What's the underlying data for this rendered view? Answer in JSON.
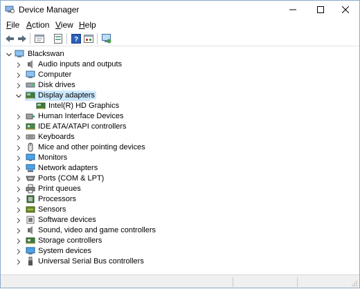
{
  "window": {
    "title": "Device Manager",
    "icon": "device-manager-icon",
    "controls": [
      "minimize-icon",
      "maximize-icon",
      "close-icon"
    ]
  },
  "menu": [
    {
      "label": "File",
      "underline": "F",
      "rest": "ile"
    },
    {
      "label": "Action",
      "underline": "A",
      "rest": "ction"
    },
    {
      "label": "View",
      "underline": "V",
      "rest": "iew"
    },
    {
      "label": "Help",
      "underline": "H",
      "rest": "elp"
    }
  ],
  "toolbar": {
    "buttons": [
      "back-arrow-icon",
      "forward-arrow-icon",
      "properties-icon",
      "update-driver-icon",
      "help-icon",
      "show-hidden-icon",
      "scan-hardware-icon"
    ]
  },
  "tree": {
    "root": "Blackswan",
    "items": [
      {
        "label": "Audio inputs and outputs",
        "icon": "speaker-icon",
        "expanded": false
      },
      {
        "label": "Computer",
        "icon": "computer-icon",
        "expanded": false
      },
      {
        "label": "Disk drives",
        "icon": "disk-drive-icon",
        "expanded": false
      },
      {
        "label": "Display adapters",
        "icon": "display-adapter-icon",
        "expanded": true,
        "selected": true,
        "children": [
          {
            "label": "Intel(R) HD Graphics",
            "icon": "display-adapter-icon"
          }
        ]
      },
      {
        "label": "Human Interface Devices",
        "icon": "hid-icon",
        "expanded": false
      },
      {
        "label": "IDE ATA/ATAPI controllers",
        "icon": "ide-controller-icon",
        "expanded": false
      },
      {
        "label": "Keyboards",
        "icon": "keyboard-icon",
        "expanded": false
      },
      {
        "label": "Mice and other pointing devices",
        "icon": "mouse-icon",
        "expanded": false
      },
      {
        "label": "Monitors",
        "icon": "monitor-icon",
        "expanded": false
      },
      {
        "label": "Network adapters",
        "icon": "network-adapter-icon",
        "expanded": false
      },
      {
        "label": "Ports (COM & LPT)",
        "icon": "port-icon",
        "expanded": false
      },
      {
        "label": "Print queues",
        "icon": "printer-icon",
        "expanded": false
      },
      {
        "label": "Processors",
        "icon": "processor-icon",
        "expanded": false
      },
      {
        "label": "Sensors",
        "icon": "sensor-icon",
        "expanded": false
      },
      {
        "label": "Software devices",
        "icon": "software-device-icon",
        "expanded": false
      },
      {
        "label": "Sound, video and game controllers",
        "icon": "sound-icon",
        "expanded": false
      },
      {
        "label": "Storage controllers",
        "icon": "storage-controller-icon",
        "expanded": false
      },
      {
        "label": "System devices",
        "icon": "system-device-icon",
        "expanded": false
      },
      {
        "label": "Universal Serial Bus controllers",
        "icon": "usb-icon",
        "expanded": false
      }
    ]
  },
  "colors": {
    "selection": "#cce8ff",
    "border": "#8aa9c9"
  }
}
